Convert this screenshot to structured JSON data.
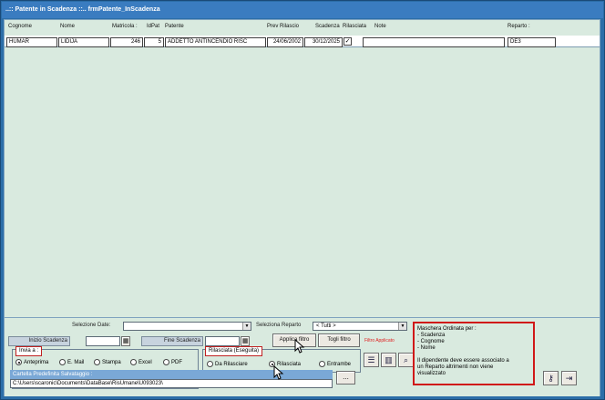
{
  "window": {
    "title": "..:: Patente in Scadenza ::..   frmPatente_InScadenza"
  },
  "columns": [
    "Cognome",
    "Nome",
    "Matricola :",
    "IdPat",
    "Patente",
    "Prev Rilascio",
    "Scadenza",
    "Rilasciata",
    "Note",
    "Reparto :"
  ],
  "row": {
    "cognome": "HUMAR",
    "nome": "LIDIJA",
    "matricola": "246",
    "idpat": "5",
    "patente": "ADDETTO ANTINCENDIO RISC",
    "prev_rilascio": "24/06/2002",
    "scadenza": "30/12/2025",
    "rilasciata_mark": "✓",
    "note": "",
    "reparto": "DE3"
  },
  "filters": {
    "selezione_date_label": "Selezione Date:",
    "selezione_date_value": "",
    "selezione_reparto_label": "Seleziona Reparto",
    "selezione_reparto_value": "<  Tutti  >",
    "inizio_label": "Inizio Scadenza",
    "inizio_value": "",
    "fine_label": "Fine Scadenza",
    "fine_value": "",
    "applica_label": "Applica filtro",
    "togli_label": "Togli filtro",
    "status_label": "Filtro Applicato"
  },
  "invia": {
    "title": "Invia a :",
    "options": [
      "Anteprima",
      "E. Mail",
      "Stampa",
      "Excel",
      "PDF"
    ],
    "selected": "Anteprima"
  },
  "rilasciata": {
    "title": "Rilasciata  (Eseguita)",
    "options": [
      "Da Rilasciare",
      "Rilasciata",
      "Entrambe"
    ],
    "selected": "Rilasciata"
  },
  "cartella": {
    "label": "Cartella Predefinita Salvataggio :",
    "path": "C:\\Users\\scaronic\\Documents\\DataBase\\RisUmane\\U093023\\",
    "browse_label": "..."
  },
  "info": {
    "lines": [
      "Maschera Ordinata per :",
      "- Scadenza",
      "- Cognome",
      "- Nome",
      "",
      "Il dipendente deve essere associato a",
      "un Reparto altrimenti non viene",
      "visualizzato"
    ]
  },
  "icons": {
    "report": "report-icon",
    "chart": "chart-icon",
    "preview": "preview-icon",
    "key": "key-icon",
    "exit": "exit-icon",
    "calendar": "calendar-icon"
  }
}
